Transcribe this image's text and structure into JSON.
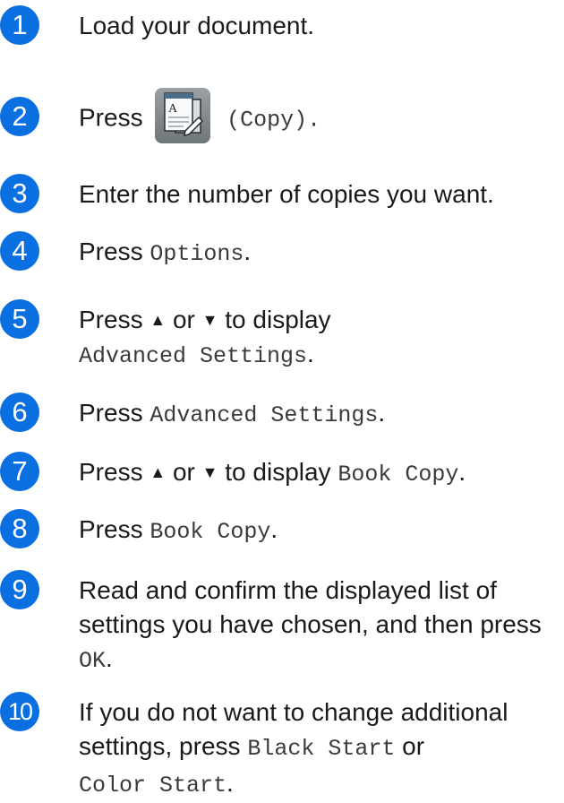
{
  "steps": [
    {
      "number": "1",
      "text": "Load your document."
    },
    {
      "number": "2",
      "press": "Press",
      "copy_label": "(Copy)."
    },
    {
      "number": "3",
      "text": "Enter the number of copies you want."
    },
    {
      "number": "4",
      "press": "Press",
      "button": "Options",
      "end": "."
    },
    {
      "number": "5",
      "press": "Press",
      "up": "▲",
      "or": "or",
      "down": "▼",
      "to_display": "to display",
      "button": "Advanced Settings",
      "end": "."
    },
    {
      "number": "6",
      "press": "Press",
      "button": "Advanced Settings",
      "end": "."
    },
    {
      "number": "7",
      "press": "Press",
      "up": "▲",
      "or": "or",
      "down": "▼",
      "to_display": "to display",
      "button": "Book Copy",
      "end": "."
    },
    {
      "number": "8",
      "press": "Press",
      "button": "Book Copy",
      "end": "."
    },
    {
      "number": "9",
      "text": "Read and confirm the displayed list of settings you have chosen, and then press",
      "button": "OK",
      "end": "."
    },
    {
      "number": "10",
      "text": "If you do not want to change additional settings, press",
      "button1": "Black Start",
      "or": "or",
      "button2": "Color Start",
      "end": "."
    }
  ],
  "icons": {
    "copy": "copy-icon"
  },
  "colors": {
    "step_circle": "#0a6fe0"
  }
}
